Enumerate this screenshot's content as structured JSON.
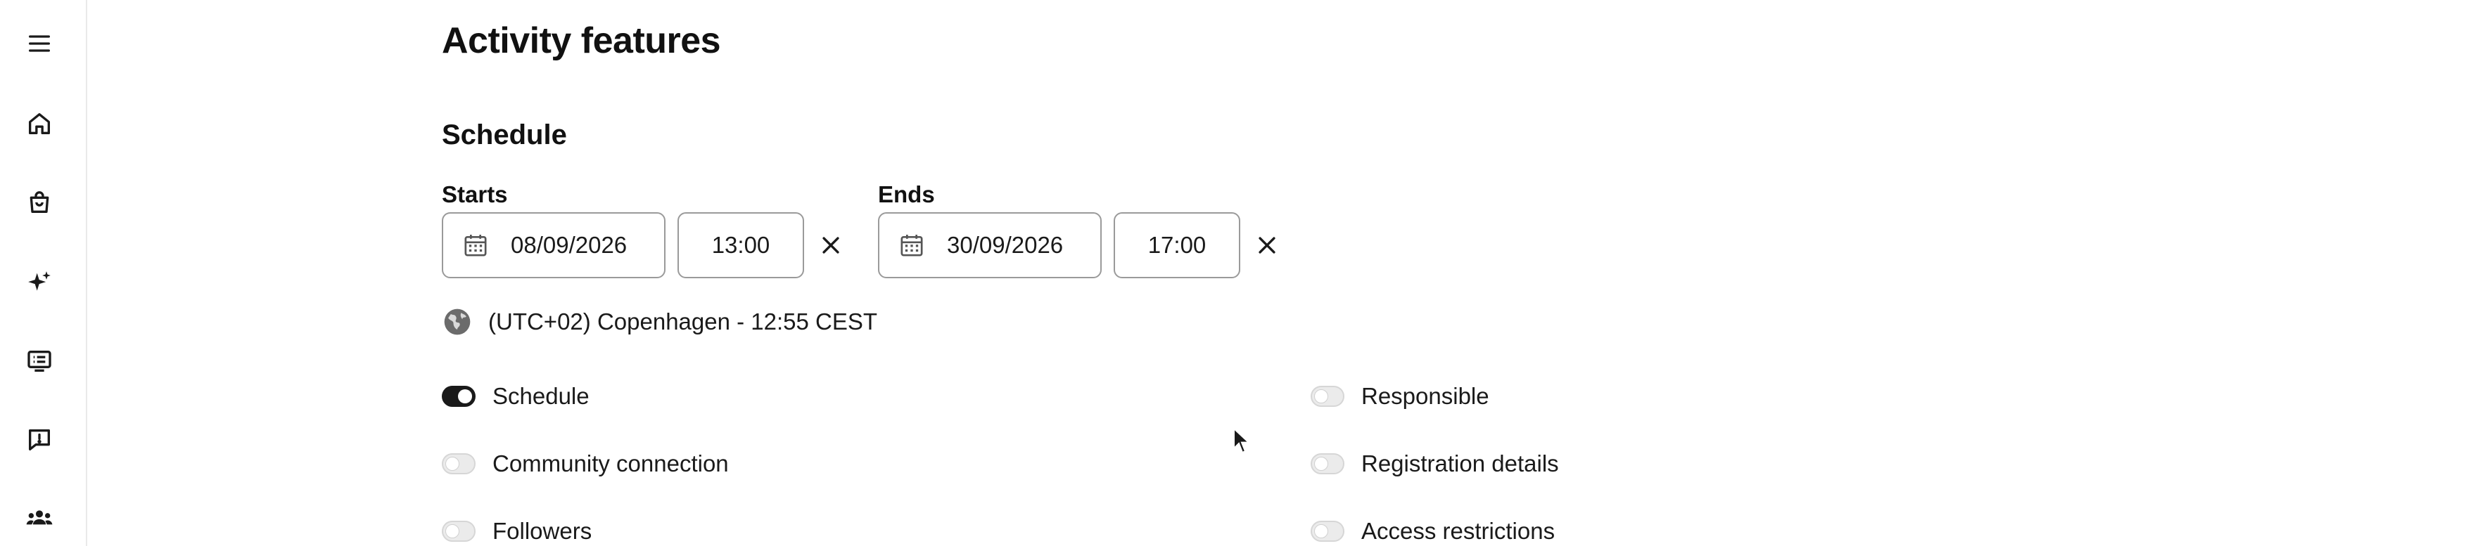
{
  "sidebar": {
    "items": [
      {
        "icon": "menu-icon"
      },
      {
        "icon": "home-icon"
      },
      {
        "icon": "shopping-bag-icon"
      },
      {
        "icon": "sparkles-icon"
      },
      {
        "icon": "list-board-icon"
      },
      {
        "icon": "feedback-icon"
      },
      {
        "icon": "community-icon"
      }
    ]
  },
  "page": {
    "title": "Activity features"
  },
  "schedule": {
    "section_title": "Schedule",
    "starts": {
      "label": "Starts",
      "date": "08/09/2026",
      "time": "13:00"
    },
    "ends": {
      "label": "Ends",
      "date": "30/09/2026",
      "time": "17:00"
    },
    "timezone": "(UTC+02) Copenhagen - 12:55 CEST"
  },
  "features": {
    "left": [
      {
        "label": "Schedule",
        "enabled": true
      },
      {
        "label": "Community connection",
        "enabled": false
      },
      {
        "label": "Followers",
        "enabled": false
      }
    ],
    "right": [
      {
        "label": "Responsible",
        "enabled": false
      },
      {
        "label": "Registration details",
        "enabled": false
      },
      {
        "label": "Access restrictions",
        "enabled": false
      }
    ]
  },
  "colors": {
    "toggle_on": "#1a1a1a",
    "toggle_off": "#ebebeb",
    "border": "#9a9a9a"
  }
}
